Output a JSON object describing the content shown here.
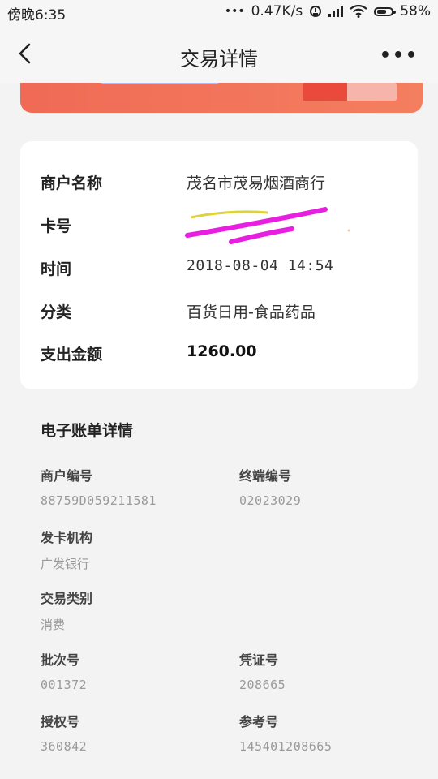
{
  "status_bar": {
    "time": "傍晚6:35",
    "dots": "•••",
    "net_speed": "0.47K/s",
    "battery": "58%"
  },
  "header": {
    "title": "交易详情",
    "more": "•••"
  },
  "detail": {
    "merchant_label": "商户名称",
    "merchant_value": "茂名市茂易烟酒商行",
    "card_label": "卡号",
    "time_label": "时间",
    "time_value": "2018-08-04 14:54",
    "category_label": "分类",
    "category_value": "百货日用-食品药品",
    "amount_label": "支出金额",
    "amount_value": "1260.00"
  },
  "bill": {
    "title": "电子账单详情",
    "merchant_no_label": "商户编号",
    "merchant_no_value": "88759D059211581",
    "terminal_no_label": "终端编号",
    "terminal_no_value": "02023029",
    "issuer_label": "发卡机构",
    "issuer_value": "广发银行",
    "tx_type_label": "交易类别",
    "tx_type_value": "消费",
    "batch_label": "批次号",
    "batch_value": "001372",
    "voucher_label": "凭证号",
    "voucher_value": "208665",
    "auth_label": "授权号",
    "auth_value": "360842",
    "ref_label": "参考号",
    "ref_value": "145401208665"
  },
  "colors": {
    "accent_red": "#f06a55",
    "redact_magenta": "#e81ee0"
  },
  "icons": [
    "back-arrow-icon",
    "signal-icon",
    "wifi-icon",
    "battery-icon",
    "more-icon"
  ]
}
